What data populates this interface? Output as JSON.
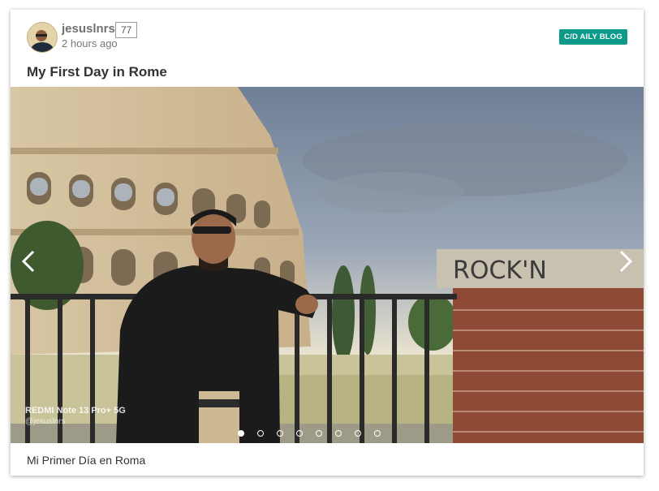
{
  "post": {
    "username": "jesuslnrs",
    "reputation": "77",
    "time_ago": "2 hours ago",
    "community_badge": "C/D AILY BLOG",
    "title": "My First Day in Rome",
    "caption": "Mi Primer Día en Roma"
  },
  "photo": {
    "graffiti_text": "ROCK'N",
    "watermark_device": "REDMI Note 13 Pro+ 5G",
    "watermark_handle": "@jesuslnrs"
  },
  "carousel": {
    "slide_count": 8,
    "active_index": 0
  },
  "colors": {
    "badge": "#0c9a8a",
    "title": "#333333"
  },
  "icons": {
    "prev": "chevron-left-icon",
    "next": "chevron-right-icon"
  }
}
